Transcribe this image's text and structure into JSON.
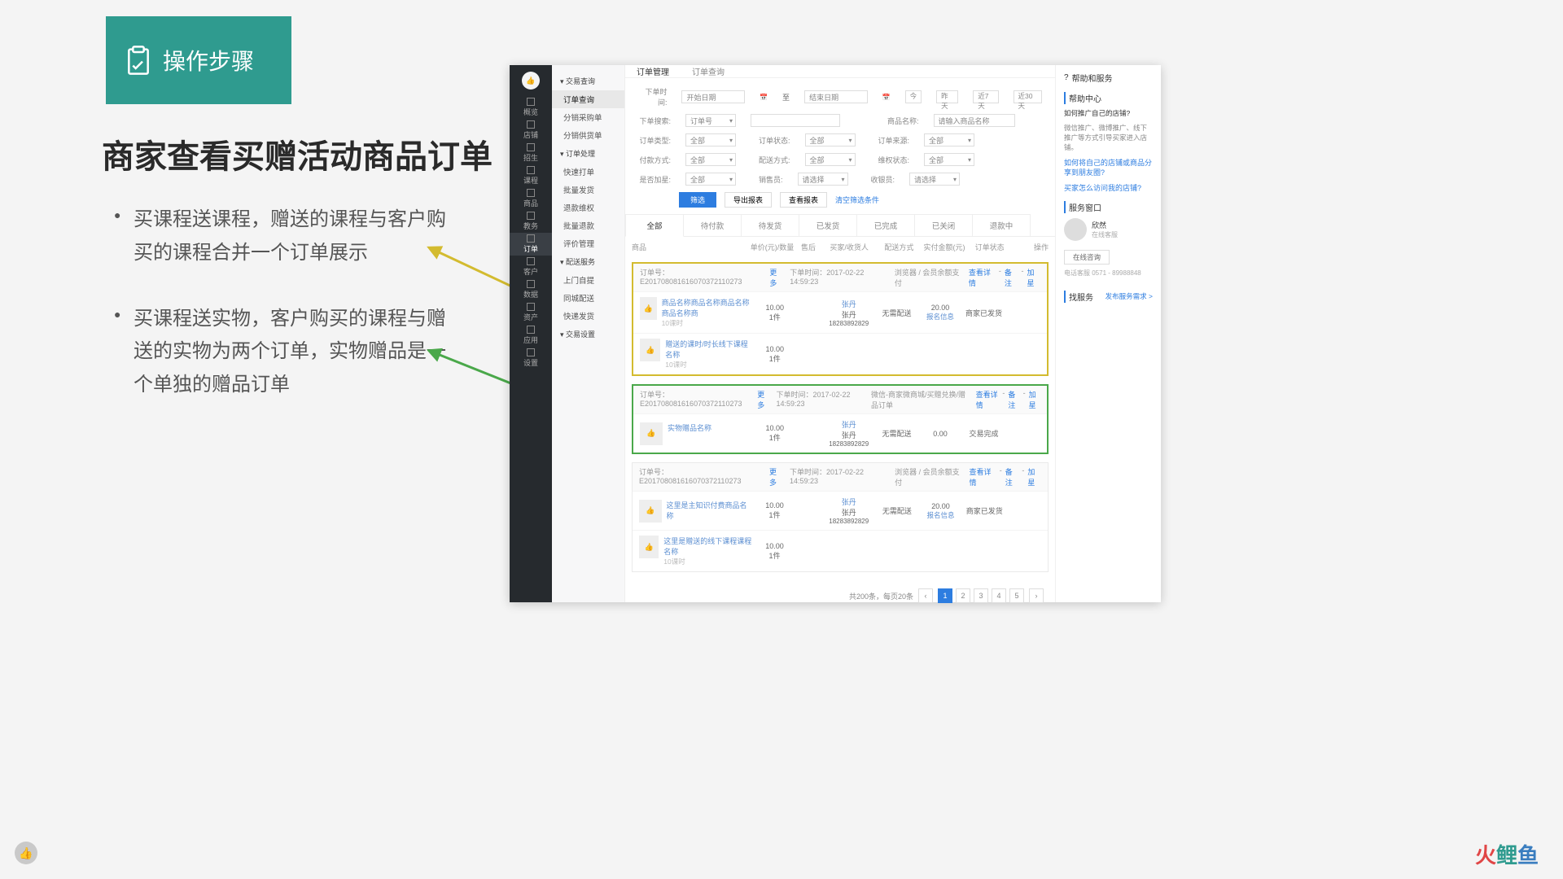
{
  "slide": {
    "header": "操作步骤",
    "title": "商家查看买赠活动商品订单",
    "bullets": [
      "买课程送课程，赠送的课程与客户购买的课程合并一个订单展示",
      "买课程送实物，客户购买的课程与赠送的实物为两个订单，实物赠品是一个单独的赠品订单"
    ],
    "footer_logo": "火鲤鱼"
  },
  "topbar": {
    "title": "订单管理",
    "sub": "订单查询"
  },
  "leftbar": [
    "概览",
    "店铺",
    "招生",
    "课程",
    "商品",
    "教务",
    "订单",
    "客户",
    "数据",
    "资产",
    "应用",
    "设置"
  ],
  "leftbar_active": "订单",
  "subnav": {
    "groups": [
      {
        "title": "交易查询",
        "items": [
          "订单查询",
          "分销采购单",
          "分销供货单"
        ],
        "active": "订单查询"
      },
      {
        "title": "订单处理",
        "items": [
          "快速打单",
          "批量发货",
          "退款维权",
          "批量退款",
          "评价管理"
        ]
      },
      {
        "title": "配送服务",
        "items": [
          "上门自提",
          "同城配送",
          "快递发货"
        ]
      },
      {
        "title": "交易设置",
        "items": []
      }
    ]
  },
  "filters": {
    "time_label": "下单时间:",
    "date_from_ph": "开始日期",
    "date_sep": "至",
    "date_to_ph": "结束日期",
    "quick": [
      "今",
      "昨天",
      "近7天",
      "近30天"
    ],
    "search_label": "下单搜索:",
    "search_type": "订单号",
    "goods_label": "商品名称:",
    "goods_ph": "请输入商品名称",
    "type_label": "订单类型:",
    "status_label": "订单状态:",
    "source_label": "订单来源:",
    "pay_label": "付款方式:",
    "deliver_label": "配送方式:",
    "rights_label": "维权状态:",
    "star_label": "是否加星:",
    "sales_label": "销售员:",
    "cashier_label": "收银员:",
    "all": "全部",
    "please_select": "请选择",
    "btn_filter": "筛选",
    "btn_export": "导出报表",
    "btn_report": "查看报表",
    "btn_clear": "清空筛选条件"
  },
  "tabs": [
    "全部",
    "待付款",
    "待发货",
    "已发货",
    "已完成",
    "已关闭",
    "退款中"
  ],
  "tabs_active": "全部",
  "columns": {
    "goods": "商品",
    "price": "单价(元)/数量",
    "after": "售后",
    "buyer": "买家/收货人",
    "deliver": "配送方式",
    "amount": "实付金额(元)",
    "status": "订单状态",
    "op": "操作"
  },
  "orders": [
    {
      "highlight": "yellow",
      "no": "订单号：E201708081616070372110273",
      "more": "更多",
      "time": "下单时间：2017-02-22 14:59:23",
      "channel": "浏览器 / 会员余额支付",
      "links": [
        "查看详情",
        "备注",
        "加星"
      ],
      "rows": [
        {
          "name": "商品名称商品名称商品名称商品名称商",
          "sub": "10课时",
          "price": "10.00",
          "qty": "1件",
          "buyer": "张丹",
          "buyer2": "张丹",
          "phone": "18283892829",
          "deliver": "无需配送",
          "amount": "20.00",
          "amount_sub": "报名信息",
          "status": "商家已发货"
        },
        {
          "name": "赠送的课时/时长线下课程名称",
          "sub": "10课时",
          "price": "10.00",
          "qty": "1件"
        }
      ]
    },
    {
      "highlight": "green",
      "no": "订单号：E201708081616070372110273",
      "more": "更多",
      "time": "下单时间：2017-02-22 14:59:23",
      "channel": "微信-商家微商城/买赠兑换/赠品订单",
      "links": [
        "查看详情",
        "备注",
        "加星"
      ],
      "rows": [
        {
          "name": "实物赠品名称",
          "sub": "",
          "price": "10.00",
          "qty": "1件",
          "buyer": "张丹",
          "buyer2": "张丹",
          "phone": "18283892829",
          "deliver": "无需配送",
          "amount": "0.00",
          "amount_sub": "",
          "status": "交易完成"
        }
      ]
    },
    {
      "highlight": "",
      "no": "订单号：E201708081616070372110273",
      "more": "更多",
      "time": "下单时间：2017-02-22 14:59:23",
      "channel": "浏览器 / 会员余额支付",
      "links": [
        "查看详情",
        "备注",
        "加星"
      ],
      "rows": [
        {
          "name": "这里是主知识付费商品名称",
          "sub": "",
          "price": "10.00",
          "qty": "1件",
          "buyer": "张丹",
          "buyer2": "张丹",
          "phone": "18283892829",
          "deliver": "无需配送",
          "amount": "20.00",
          "amount_sub": "报名信息",
          "status": "商家已发货"
        },
        {
          "name": "这里是赠送的线下课程课程名称",
          "sub": "10课时",
          "price": "10.00",
          "qty": "1件"
        }
      ]
    }
  ],
  "pager": {
    "info": "共200条，每页20条",
    "pages": [
      "1",
      "2",
      "3",
      "4",
      "5"
    ],
    "active": "1"
  },
  "rpanel": {
    "title": "帮助和服务",
    "help_sec": "帮助中心",
    "q1": "如何推广自己的店铺?",
    "q1_desc": "微信推广、微博推广、线下推广等方式引导买家进入店铺。",
    "q2": "如何将自己的店铺或商品分享到朋友圈?",
    "q3": "买家怎么访问我的店铺?",
    "service_sec": "服务窗口",
    "service_name": "欣然",
    "service_role": "在线客服",
    "chat_btn": "在线咨询",
    "phone_label": "电话客服",
    "phone": "0571 - 89988848",
    "find_sec": "找服务",
    "find_link": "发布服务需求 >"
  }
}
